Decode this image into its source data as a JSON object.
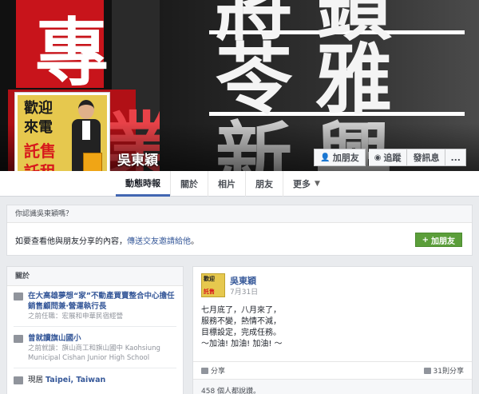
{
  "profile": {
    "name": "吳東穎",
    "picture_lines": [
      "歡迎",
      "來電",
      "託售",
      "託租"
    ]
  },
  "cover": {
    "chars_left": [
      "專",
      "業"
    ],
    "chars_right": [
      "將",
      "鎖",
      "苓",
      "雅",
      "新",
      "興"
    ]
  },
  "actions": {
    "add_friend": "加朋友",
    "follow": "追蹤",
    "message": "發訊息",
    "more": "..."
  },
  "tabs": [
    {
      "label": "動態時報"
    },
    {
      "label": "關於"
    },
    {
      "label": "相片"
    },
    {
      "label": "朋友"
    },
    {
      "label": "更多"
    }
  ],
  "know_box": {
    "title": "你認識吳東穎嗎？",
    "text": "如要查看他與朋友分享的內容，",
    "link": "傳送交友邀請給他",
    "text_end": "。",
    "add_button": "加朋友"
  },
  "about": {
    "title": "關於",
    "items": [
      {
        "main": "在大高雄夢想“家”不動產買賣整合中心擔任銷售顧問兼‧營運執行長",
        "sub": "之前任職：宏展和申華民宿經營"
      },
      {
        "main": "曾就讀旗山國小",
        "sub": "之前就讀：旗山商工和旗山國中 Kaohsiung Municipal Cishan Junior High School"
      },
      {
        "prefix": "現居 ",
        "main": "Taipei, Taiwan"
      }
    ]
  },
  "post": {
    "author": "吳東穎",
    "date": "7月31日",
    "lines": [
      "七月底了，八月來了，",
      "服務不變，熱情不減，",
      "目標設定，完成任務。",
      "～加油! 加油! 加油! ～"
    ],
    "share": "分享",
    "share_count": "31則分享",
    "likes": "458 個人都說讚。"
  }
}
